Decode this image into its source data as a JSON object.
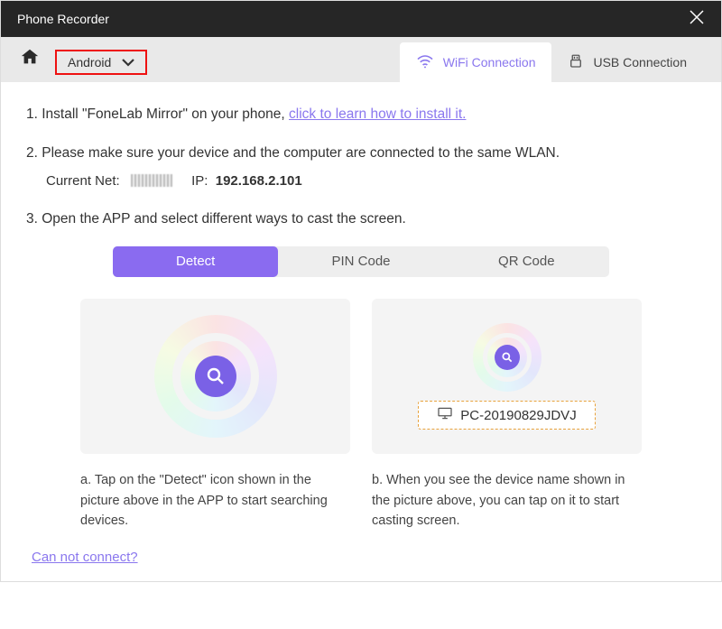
{
  "titlebar": {
    "title": "Phone Recorder"
  },
  "topbar": {
    "platform": "Android"
  },
  "conn_tabs": {
    "wifi": "WiFi Connection",
    "usb": "USB Connection"
  },
  "steps": {
    "s1_prefix": "1. Install \"FoneLab Mirror\" on your phone, ",
    "s1_link": "click to learn how to install it.",
    "s2": "2. Please make sure your device and the computer are connected to the same WLAN.",
    "net_label": "Current Net:",
    "ip_label": "IP:",
    "ip_value": "192.168.2.101",
    "s3": "3. Open the APP and select different ways to cast the screen."
  },
  "methods": {
    "detect": "Detect",
    "pin": "PIN Code",
    "qr": "QR Code"
  },
  "panels": {
    "device_name": "PC-20190829JDVJ",
    "caption_a": "a. Tap on the \"Detect\" icon shown in the picture above in the APP to start searching devices.",
    "caption_b": "b. When you see the device name shown in the picture above, you can tap on it to start casting screen."
  },
  "footer": {
    "cannot_connect": "Can not connect?"
  }
}
